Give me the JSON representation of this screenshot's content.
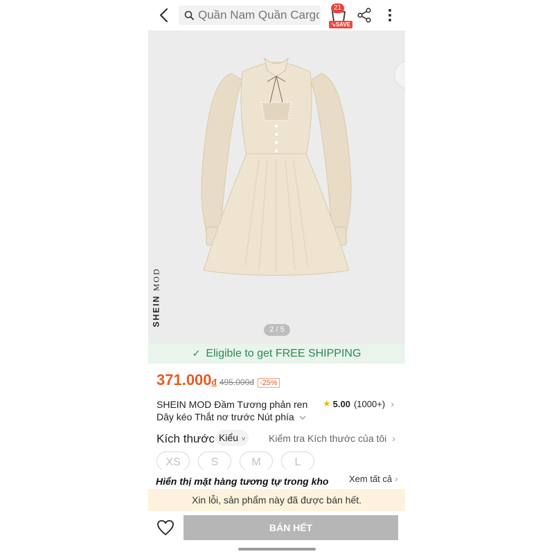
{
  "header": {
    "search_placeholder": "Quần Nam Quần Cargo",
    "cart_count": "21",
    "save_tag": "SAVE"
  },
  "gallery": {
    "brand_bold": "SHEIN",
    "brand_light": "MOD",
    "pager": "2 / 5"
  },
  "shipping": {
    "text": "Eligible to get FREE SHIPPING"
  },
  "price": {
    "current": "371.000",
    "currency": "đ",
    "original": "495.000đ",
    "discount": "-25%"
  },
  "product": {
    "title": "SHEIN MOD Đầm Tương phản ren Dây kéo Thắt nơ trước Nút phía",
    "rating": "5.00",
    "rating_count": "(1000+)"
  },
  "size": {
    "label": "Kích thước",
    "dropdown": "Kiểu",
    "check_link": "Kiểm tra Kích thước của tôi",
    "options": [
      "XS",
      "S",
      "M",
      "L"
    ]
  },
  "similar": {
    "heading": "Hiển thị mặt hàng tương tự trong kho",
    "see_all": "Xem tất cả"
  },
  "notice": "Xin lỗi, sản phẩm này đã được bán hết.",
  "bottom": {
    "buy_label": "BÁN HẾT"
  },
  "colors": {
    "price": "#e85a22",
    "shipping_bg": "#e8f4ec",
    "shipping_text": "#2c8a53",
    "notice_bg": "#fdf3dd",
    "button_disabled": "#b6b6b6"
  }
}
